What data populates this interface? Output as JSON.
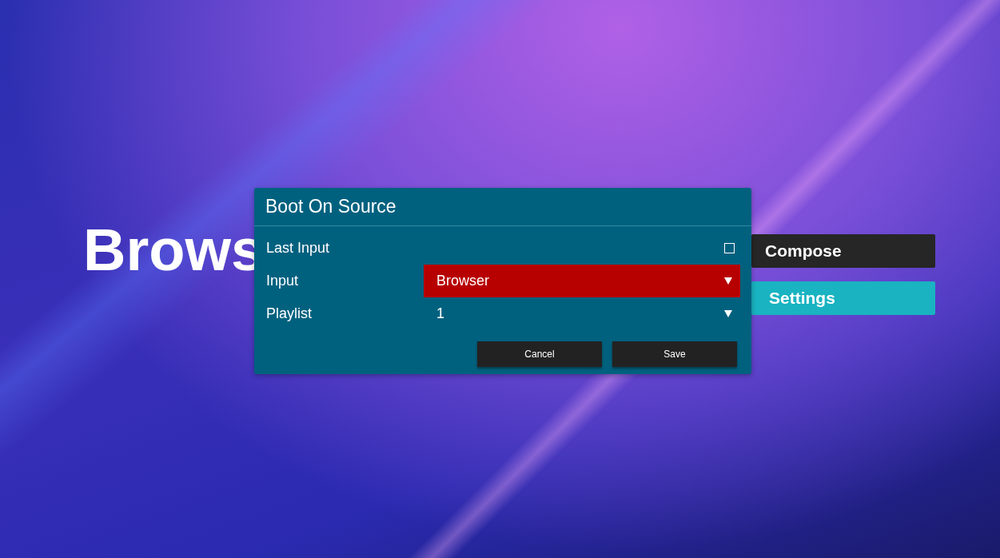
{
  "background_title": "Brows",
  "menu": [
    {
      "label": "Compose",
      "selected": false
    },
    {
      "label": "Settings",
      "selected": true
    }
  ],
  "dialog": {
    "title": "Boot On Source",
    "rows": [
      {
        "kind": "checkbox",
        "label": "Last Input",
        "checked": false
      },
      {
        "kind": "select",
        "label": "Input",
        "value": "Browser",
        "focused": true
      },
      {
        "kind": "select",
        "label": "Playlist",
        "value": "1",
        "focused": false
      }
    ],
    "buttons": [
      "Cancel",
      "Save"
    ]
  }
}
